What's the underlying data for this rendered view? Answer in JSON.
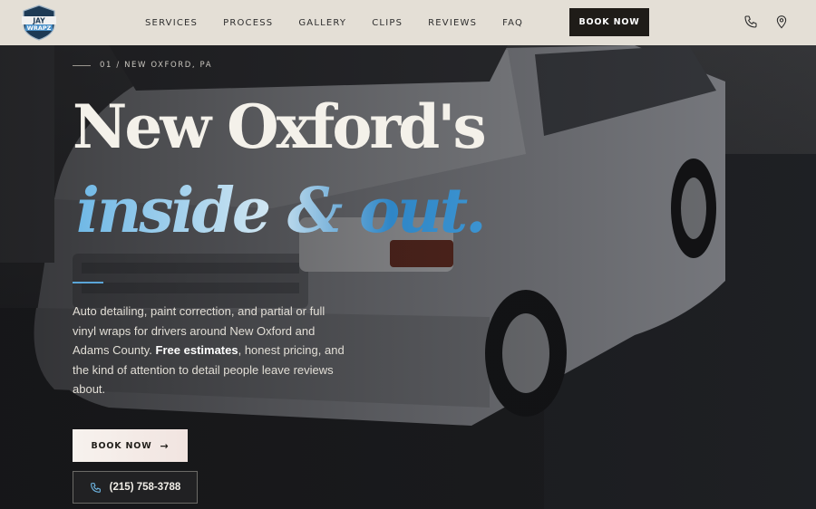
{
  "header": {
    "logo_text": "JAY WRAPZ",
    "nav": [
      "SERVICES",
      "PROCESS",
      "GALLERY",
      "CLIPS",
      "REVIEWS",
      "FAQ"
    ],
    "book_label": "BOOK NOW",
    "icons": [
      "phone-icon",
      "location-pin-icon"
    ]
  },
  "hero": {
    "eyebrow": "01 / NEW OXFORD, PA",
    "headline_line1": "New Oxford's",
    "headline_line2_a": "inside ",
    "headline_line2_amp": "&",
    "headline_line2_b": " out",
    "headline_line2_dot": ".",
    "lead_before": "Auto detailing, paint correction, and partial or full vinyl wraps for drivers around New Oxford and Adams County. ",
    "lead_bold": "Free estimates",
    "lead_after": ", honest pricing, and the kind of attention to detail people leave reviews about.",
    "cta_book": "BOOK NOW",
    "cta_phone": "(215) 758-3788"
  },
  "colors": {
    "header_bg": "#e4dfd6",
    "accent_blue": "#4aa2dc",
    "dark_button": "#1f1c18"
  }
}
